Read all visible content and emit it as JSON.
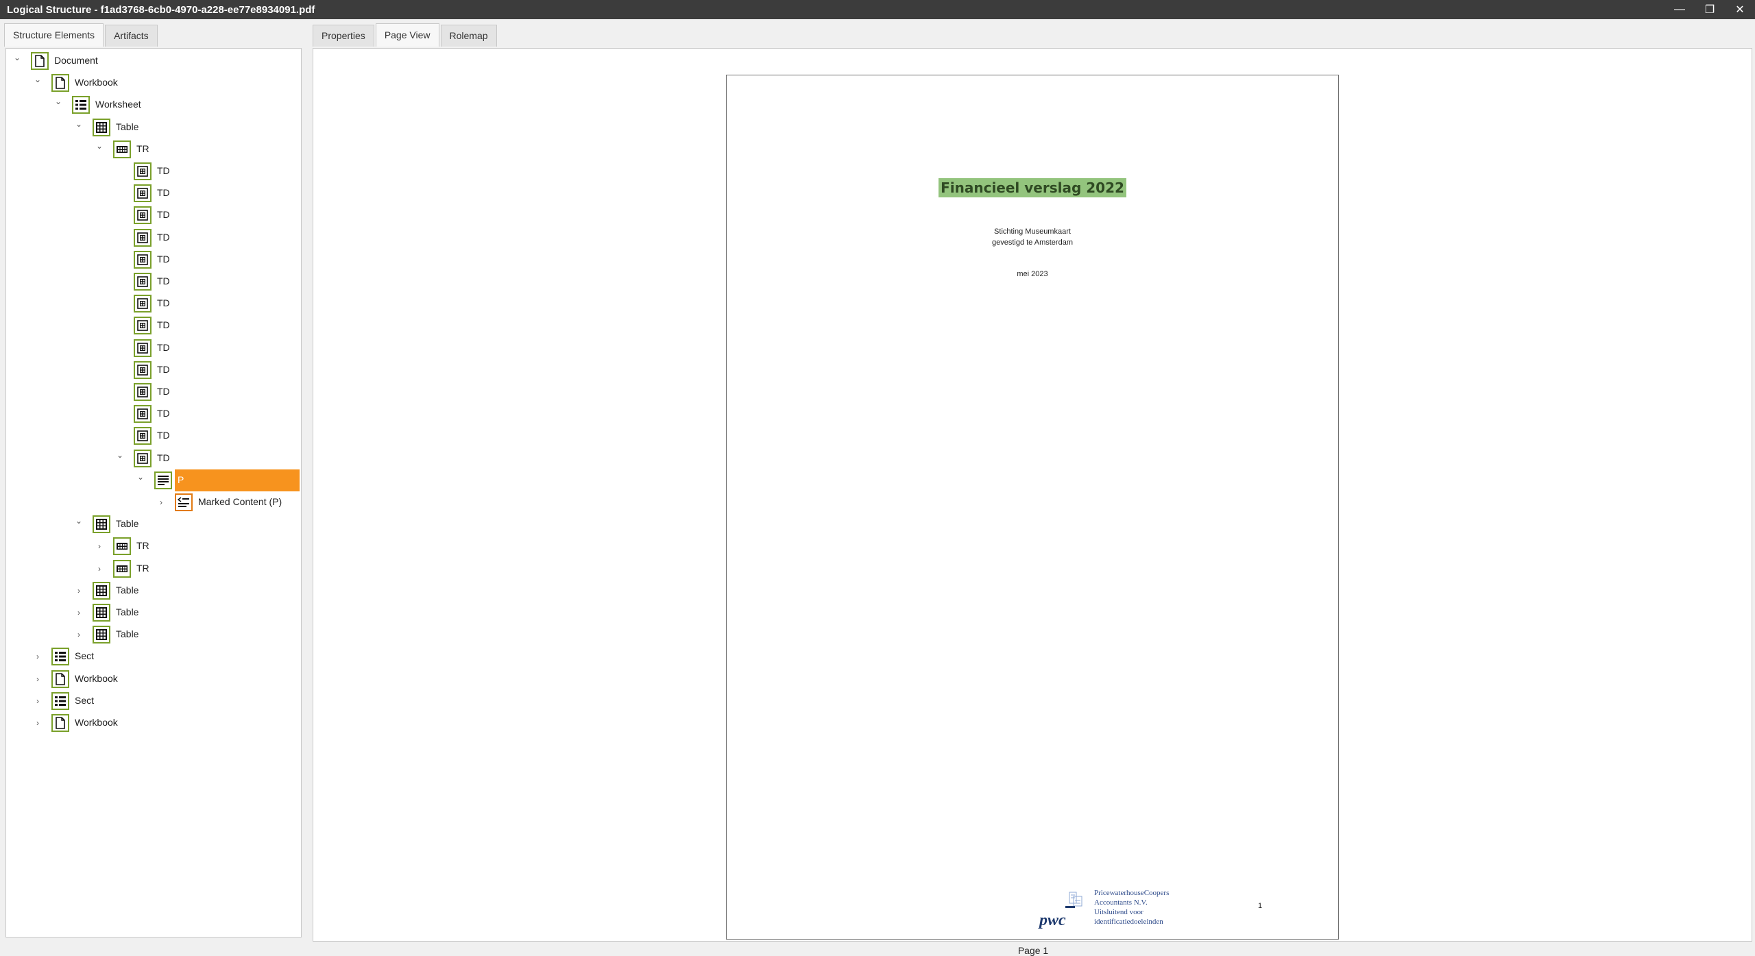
{
  "window": {
    "title": "Logical Structure - f1ad3768-6cb0-4970-a228-ee77e8934091.pdf",
    "minimize": "—",
    "restore": "❐",
    "close": "✕"
  },
  "left_tabs": [
    "Structure Elements",
    "Artifacts"
  ],
  "right_tabs": [
    "Properties",
    "Page View",
    "Rolemap"
  ],
  "tree": [
    {
      "label": "Document",
      "icon": "document-icon",
      "expanded": true
    },
    {
      "label": "Workbook",
      "icon": "document-icon",
      "expanded": true
    },
    {
      "label": "Worksheet",
      "icon": "list-icon",
      "expanded": true
    },
    {
      "label": "Table",
      "icon": "table-icon",
      "expanded": true
    },
    {
      "label": "TR",
      "icon": "table-row-icon",
      "expanded": true
    },
    {
      "label": "TD",
      "icon": "table-cell-icon"
    },
    {
      "label": "TD",
      "icon": "table-cell-icon"
    },
    {
      "label": "TD",
      "icon": "table-cell-icon"
    },
    {
      "label": "TD",
      "icon": "table-cell-icon"
    },
    {
      "label": "TD",
      "icon": "table-cell-icon"
    },
    {
      "label": "TD",
      "icon": "table-cell-icon"
    },
    {
      "label": "TD",
      "icon": "table-cell-icon"
    },
    {
      "label": "TD",
      "icon": "table-cell-icon"
    },
    {
      "label": "TD",
      "icon": "table-cell-icon"
    },
    {
      "label": "TD",
      "icon": "table-cell-icon"
    },
    {
      "label": "TD",
      "icon": "table-cell-icon"
    },
    {
      "label": "TD",
      "icon": "table-cell-icon"
    },
    {
      "label": "TD",
      "icon": "table-cell-icon"
    },
    {
      "label": "TD",
      "icon": "table-cell-icon",
      "expanded": true
    },
    {
      "label": "P",
      "icon": "paragraph-icon",
      "expanded": true,
      "selected": true
    },
    {
      "label": "Marked Content (P)",
      "icon": "marked-content-icon",
      "expanded": false
    },
    {
      "label": "Table",
      "icon": "table-icon",
      "expanded": true
    },
    {
      "label": "TR",
      "icon": "table-row-icon",
      "expanded": false
    },
    {
      "label": "TR",
      "icon": "table-row-icon",
      "expanded": false
    },
    {
      "label": "Table",
      "icon": "table-icon",
      "expanded": false
    },
    {
      "label": "Table",
      "icon": "table-icon",
      "expanded": false
    },
    {
      "label": "Table",
      "icon": "table-icon",
      "expanded": false
    },
    {
      "label": "Sect",
      "icon": "list-icon",
      "expanded": false
    },
    {
      "label": "Workbook",
      "icon": "document-icon",
      "expanded": false
    },
    {
      "label": "Sect",
      "icon": "list-icon",
      "expanded": false
    },
    {
      "label": "Workbook",
      "icon": "document-icon",
      "expanded": false
    }
  ],
  "page": {
    "title": "Financieel verslag 2022",
    "org": "Stichting Museumkaart",
    "location": "gevestigd te Amsterdam",
    "date": "mei 2023",
    "logo_text": "pwc",
    "footer_lines": [
      "PricewaterhouseCoopers",
      "Accountants N.V.",
      "Uitsluitend voor",
      "identificatiedoeleinden"
    ],
    "page_number": "1",
    "page_label": "Page 1"
  },
  "colors": {
    "selection": "#f7931e",
    "icon_border": "#7aa02a",
    "title_highlight": "#93c47d"
  }
}
